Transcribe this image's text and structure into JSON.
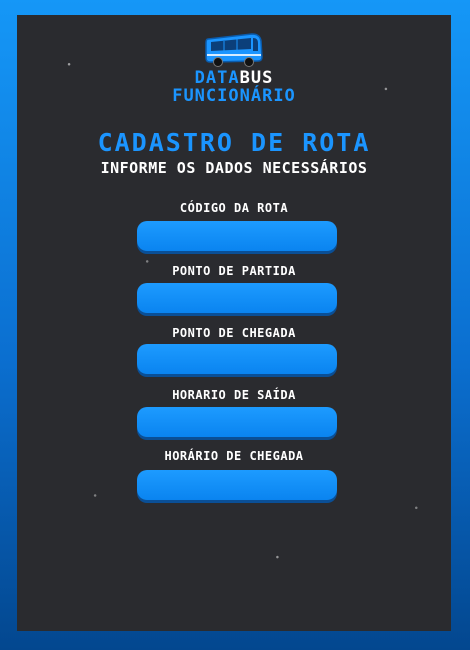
{
  "brand": {
    "line1_blue": "DATA",
    "line1_white": "BUS",
    "line2": "FUNCIONÁRIO",
    "icon": "bus-icon"
  },
  "header": {
    "title": "CADASTRO DE ROTA",
    "subtitle": "INFORME OS DADOS NECESSÁRIOS"
  },
  "form": {
    "fields": [
      {
        "label": "CÓDIGO DA ROTA",
        "value": ""
      },
      {
        "label": "PONTO DE PARTIDA",
        "value": ""
      },
      {
        "label": "PONTO DE CHEGADA",
        "value": ""
      },
      {
        "label": "HORARIO DE SAÍDA",
        "value": ""
      },
      {
        "label": "HORÁRIO DE CHEGADA",
        "value": ""
      }
    ]
  },
  "colors": {
    "accent": "#1b95ff",
    "card": "#2a2b2f",
    "text": "#ffffff"
  }
}
